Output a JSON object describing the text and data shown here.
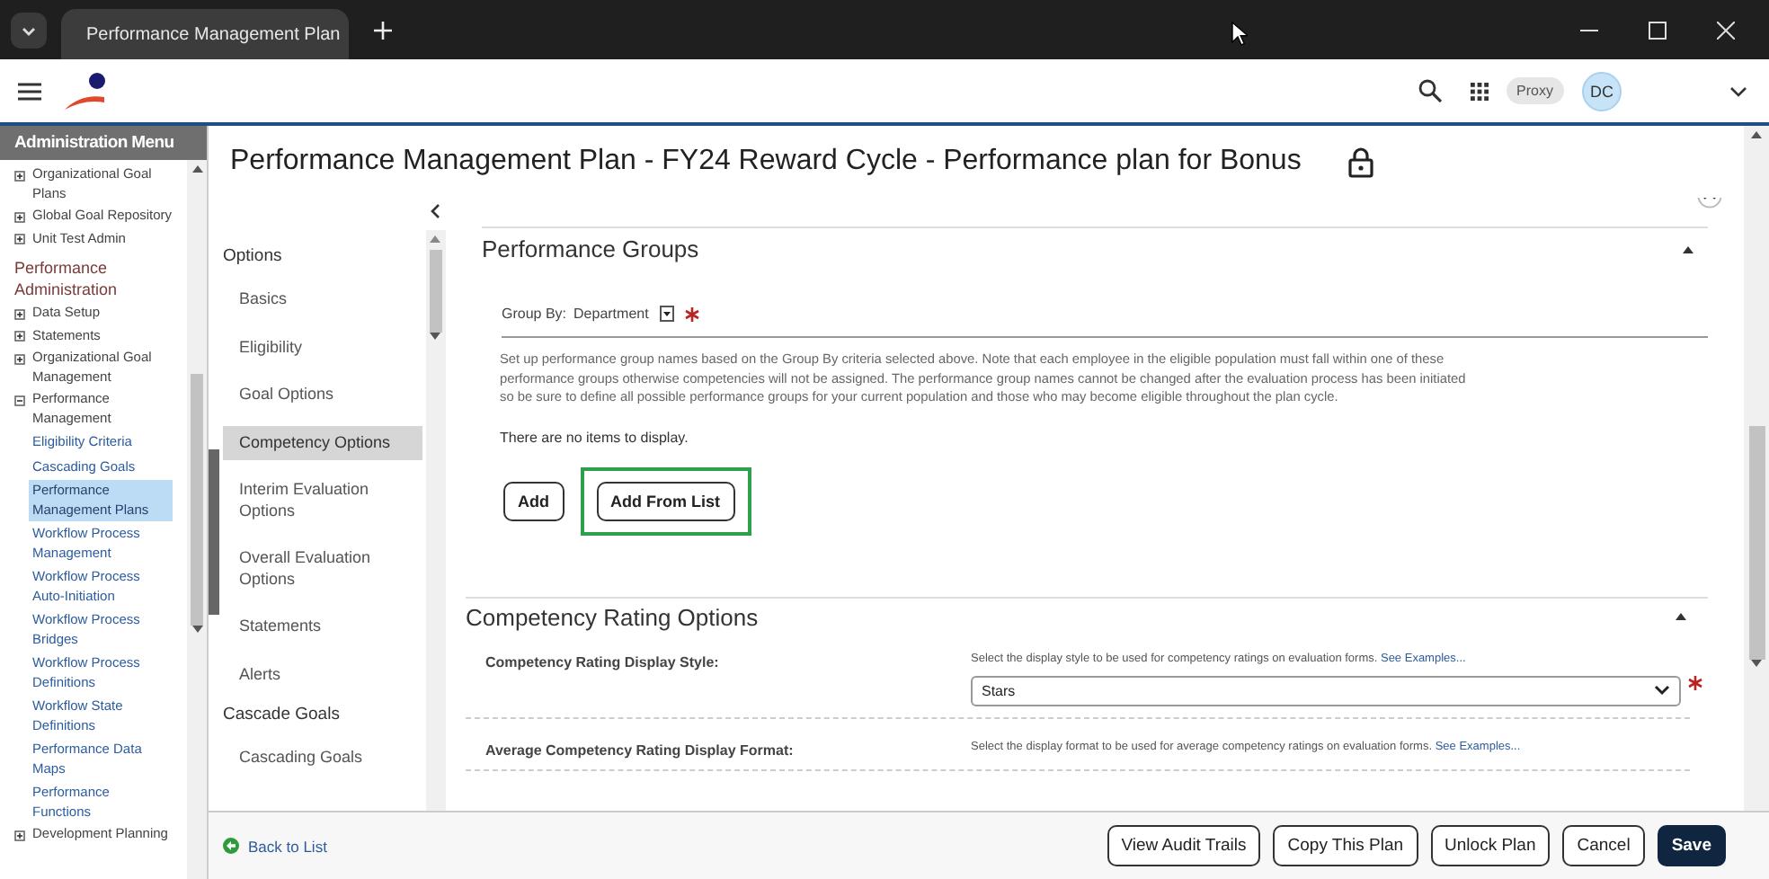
{
  "browser": {
    "tab_title": "Performance Management Plan"
  },
  "header": {
    "proxy": "Proxy",
    "avatar": "DC"
  },
  "sidebar": {
    "title": "Administration Menu",
    "items": [
      {
        "kind": "node",
        "label": "Organizational Goal Plans",
        "expanded": false
      },
      {
        "kind": "node",
        "label": "Global Goal Repository",
        "expanded": false
      },
      {
        "kind": "node",
        "label": "Unit Test Admin",
        "expanded": false
      },
      {
        "kind": "heading",
        "label": "Performance Administration"
      },
      {
        "kind": "node",
        "label": "Data Setup",
        "expanded": false
      },
      {
        "kind": "node",
        "label": "Statements",
        "expanded": false
      },
      {
        "kind": "node",
        "label": "Organizational Goal Management",
        "expanded": false
      },
      {
        "kind": "node",
        "label": "Performance Management",
        "expanded": true,
        "children": [
          {
            "label": "Eligibility Criteria",
            "selected": false
          },
          {
            "label": "Cascading Goals",
            "selected": false
          },
          {
            "label": "Performance Management Plans",
            "selected": true
          },
          {
            "label": "Workflow Process Management",
            "selected": false
          },
          {
            "label": "Workflow Process Auto-Initiation",
            "selected": false
          },
          {
            "label": "Workflow Process Bridges",
            "selected": false
          },
          {
            "label": "Workflow Process Definitions",
            "selected": false
          },
          {
            "label": "Workflow State Definitions",
            "selected": false
          },
          {
            "label": "Performance Data Maps",
            "selected": false
          },
          {
            "label": "Performance Functions",
            "selected": false
          }
        ]
      },
      {
        "kind": "node",
        "label": "Development Planning",
        "expanded": false
      }
    ]
  },
  "page": {
    "title": "Performance Management Plan - FY24 Reward Cycle - Performance plan for Bonus"
  },
  "options_nav": {
    "groups": [
      {
        "heading": "Options",
        "items": [
          {
            "label": "Basics",
            "selected": false
          },
          {
            "label": "Eligibility",
            "selected": false
          },
          {
            "label": "Goal Options",
            "selected": false
          },
          {
            "label": "Competency Options",
            "selected": true
          },
          {
            "label": "Interim Evaluation Options",
            "selected": false
          },
          {
            "label": "Overall Evaluation Options",
            "selected": false
          },
          {
            "label": "Statements",
            "selected": false
          },
          {
            "label": "Alerts",
            "selected": false
          }
        ]
      },
      {
        "heading": "Cascade Goals",
        "items": [
          {
            "label": "Cascading Goals",
            "selected": false
          }
        ]
      }
    ]
  },
  "performance_groups": {
    "title": "Performance Groups",
    "expanded": true,
    "group_by_label": "Group By:",
    "group_by_value": "Department",
    "required": true,
    "help": "Set up performance group names based on the Group By criteria selected above. Note that each employee in the eligible population must fall within one of these performance groups otherwise competencies will not be assigned. The performance group names cannot be changed after the evaluation process has been initiated so be sure to define all possible performance groups for your current population and those who may become eligible throughout the plan cycle.",
    "empty_message": "There are no items to display.",
    "buttons": [
      {
        "label": "Add",
        "highlighted": false
      },
      {
        "label": "Add From List",
        "highlighted": true
      }
    ]
  },
  "competency_rating": {
    "title": "Competency Rating Options",
    "expanded": true,
    "rows": [
      {
        "label": "Competency Rating Display Style:",
        "hint": "Select the display style to be used for competency ratings on evaluation forms.",
        "link": "See Examples...",
        "value": "Stars",
        "required": true
      },
      {
        "label": "Average Competency Rating Display Format:",
        "hint": "Select the display format to be used for average competency ratings on evaluation forms.",
        "link": "See Examples..."
      }
    ]
  },
  "footer": {
    "back_link": "Back to List",
    "buttons": [
      {
        "label": "View Audit Trails",
        "primary": false
      },
      {
        "label": "Copy This Plan",
        "primary": false
      },
      {
        "label": "Unlock Plan",
        "primary": false
      },
      {
        "label": "Cancel",
        "primary": false
      },
      {
        "label": "Save",
        "primary": true
      }
    ]
  }
}
